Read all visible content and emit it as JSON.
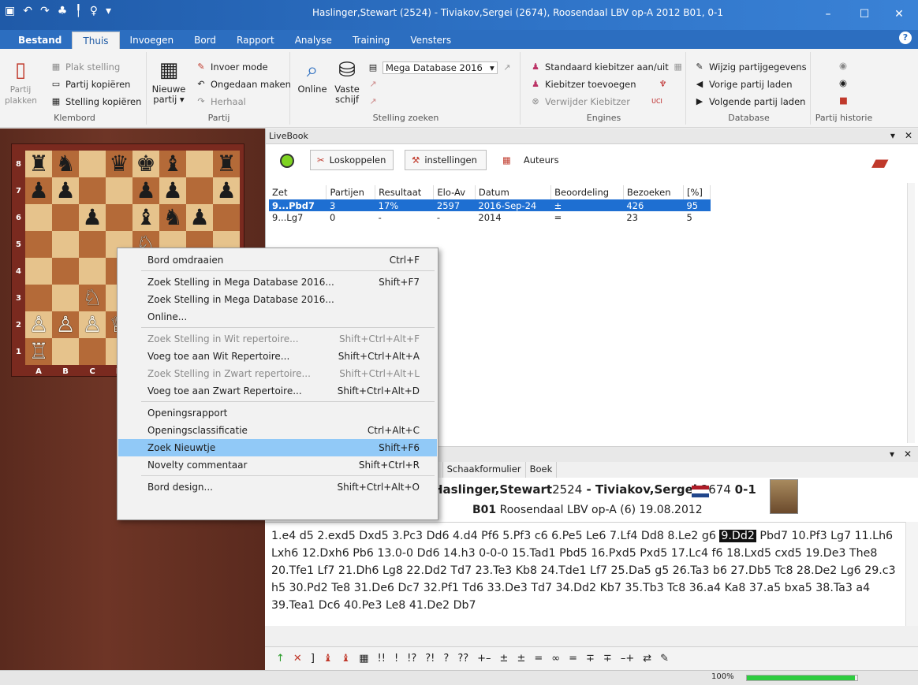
{
  "window": {
    "title": "Haslinger,Stewart (2524) - Tiviakov,Sergei (2674), Roosendaal LBV op-A 2012  B01, 0-1",
    "quick_access_icons": [
      "save-icon",
      "undo-icon",
      "redo-icon",
      "tree-icon",
      "brush-icon",
      "bulb-icon",
      "dropdown-icon"
    ],
    "controls": {
      "minimize": "–",
      "maximize": "☐",
      "close": "✕"
    }
  },
  "ribbon_tabs": [
    "Bestand",
    "Thuis",
    "Invoegen",
    "Bord",
    "Rapport",
    "Analyse",
    "Training",
    "Vensters"
  ],
  "active_tab": "Thuis",
  "ribbon": {
    "klembord": {
      "label": "Klembord",
      "paste_big": "Partij plakken",
      "items": [
        "Plak stelling",
        "Partij kopiëren",
        "Stelling kopiëren"
      ]
    },
    "partij": {
      "label": "Partij",
      "new_game": "Nieuwe partij ▾",
      "items": [
        "Invoer mode",
        "Ongedaan maken",
        "Herhaal"
      ]
    },
    "stelling_zoeken": {
      "label": "Stelling zoeken",
      "online": "Online",
      "vaste_schijf": "Vaste schijf",
      "database": "Mega Database 2016"
    },
    "engines": {
      "label": "Engines",
      "items": [
        "Standaard kiebitzer aan/uit",
        "Kiebitzer toevoegen",
        "Verwijder Kiebitzer"
      ]
    },
    "database": {
      "label": "Database",
      "items": [
        "Wijzig partijgegevens",
        "Vorige partij laden",
        "Volgende partij laden"
      ]
    },
    "historie": {
      "label": "Partij historie"
    }
  },
  "board": {
    "ranks": [
      "8",
      "7",
      "6",
      "5",
      "4",
      "3",
      "2",
      "1"
    ],
    "files": [
      "A",
      "B",
      "C",
      "D",
      "E",
      "F",
      "G",
      "H"
    ],
    "squares": [
      [
        "♜",
        "♞",
        "",
        "♛",
        "♚",
        "♝",
        "",
        "♜"
      ],
      [
        "♟",
        "♟",
        "",
        "",
        "♟",
        "♟",
        "",
        "♟"
      ],
      [
        "",
        "",
        "♟",
        "",
        "♝",
        "♞",
        "♟",
        ""
      ],
      [
        "",
        "",
        "",
        "",
        "♘",
        "",
        "",
        ""
      ],
      [
        "",
        "",
        "",
        "",
        "",
        "",
        "",
        ""
      ],
      [
        "",
        "",
        "♘",
        "",
        "",
        "",
        "",
        ""
      ],
      [
        "♙",
        "♙",
        "♙",
        "♕",
        "",
        "",
        "",
        ""
      ],
      [
        "♖",
        "",
        "",
        "",
        "",
        "",
        "",
        ""
      ]
    ],
    "colors": [
      [
        "b",
        "b",
        "",
        "b",
        "b",
        "b",
        "",
        "b"
      ],
      [
        "b",
        "b",
        "",
        "",
        "b",
        "b",
        "",
        "b"
      ],
      [
        "",
        "",
        "b",
        "",
        "b",
        "b",
        "b",
        ""
      ],
      [
        "",
        "",
        "",
        "",
        "w",
        "",
        "",
        ""
      ],
      [
        "",
        "",
        "",
        "",
        "",
        "",
        "",
        ""
      ],
      [
        "",
        "",
        "w",
        "",
        "",
        "",
        "",
        ""
      ],
      [
        "w",
        "w",
        "w",
        "w",
        "",
        "",
        "",
        ""
      ],
      [
        "w",
        "",
        "",
        "",
        "",
        "",
        "",
        ""
      ]
    ]
  },
  "livebook": {
    "title": "LiveBook",
    "buttons": {
      "disconnect": "Loskoppelen",
      "settings": "instellingen",
      "authors": "Auteurs"
    },
    "columns": [
      "Zet",
      "Partijen",
      "Resultaat",
      "Elo-Av",
      "Datum",
      "Beoordeling",
      "Bezoeken",
      "[%]"
    ],
    "rows": [
      [
        "9...Pbd7",
        "3",
        "17%",
        "2597",
        "2016-Sep-24",
        "±",
        "426",
        "95"
      ],
      [
        "9...Lg7",
        "0",
        "-",
        "-",
        "2014",
        "=",
        "23",
        "5"
      ]
    ]
  },
  "context_menu": {
    "items": [
      {
        "label": "Bord omdraaien",
        "shortcut": "Ctrl+F",
        "disabled": false
      },
      {
        "label": "Zoek Stelling in Mega Database 2016...",
        "shortcut": "Shift+F7",
        "disabled": false
      },
      {
        "label": "Zoek Stelling in Mega Database 2016...",
        "shortcut": "",
        "disabled": false
      },
      {
        "label": "Online...",
        "shortcut": "",
        "disabled": false
      },
      {
        "label": "Zoek Stelling in Wit repertoire...",
        "shortcut": "Shift+Ctrl+Alt+F",
        "disabled": true
      },
      {
        "label": "Voeg toe aan Wit Repertoire...",
        "shortcut": "Shift+Ctrl+Alt+A",
        "disabled": false
      },
      {
        "label": "Zoek Stelling in Zwart repertoire...",
        "shortcut": "Shift+Ctrl+Alt+L",
        "disabled": true
      },
      {
        "label": "Voeg toe aan Zwart Repertoire...",
        "shortcut": "Shift+Ctrl+Alt+D",
        "disabled": false
      },
      {
        "label": "Openingsrapport",
        "shortcut": "",
        "disabled": false
      },
      {
        "label": "Openingsclassificatie",
        "shortcut": "Ctrl+Alt+C",
        "disabled": false
      },
      {
        "label": "Zoek Nieuwtje",
        "shortcut": "Shift+F6",
        "disabled": false,
        "highlighted": true
      },
      {
        "label": "Novelty commentaar",
        "shortcut": "Shift+Ctrl+R",
        "disabled": false
      },
      {
        "label": "Bord design...",
        "shortcut": "Shift+Ctrl+Alt+O",
        "disabled": false
      }
    ]
  },
  "notation": {
    "tabs": [
      "ng",
      "Schaakformulier",
      "Boek"
    ],
    "white": "Haslinger,Stewart",
    "white_elo": "2524",
    "separator": " - ",
    "black": "Tiviakov,Sergei",
    "black_elo": "2674",
    "result": "0-1",
    "eco": "B01",
    "event": "Roosendaal LBV op-A (6) 19.08.2012",
    "moves_before": "1.e4 d5 2.exd5 Dxd5 3.Pc3 Dd6 4.d4 Pf6 5.Pf3 c6 6.Pe5 Le6 7.Lf4 Dd8 8.Le2 g6 ",
    "current_move": "9.Dd2",
    "moves_after": " Pbd7 10.Pf3 Lg7 11.Lh6 Lxh6 12.Dxh6 Pb6 13.0-0 Dd6 14.h3 0-0-0 15.Tad1 Pbd5 16.Pxd5 Pxd5 17.Lc4 f6 18.Lxd5 cxd5 19.De3 The8 20.Tfe1 Lf7 21.Dh6 Lg8 22.Dd2 Td7 23.Te3 Kb8 24.Tde1 Lf7 25.Da5 g5 26.Ta3 b6 27.Db5 Tc8 28.De2 Lg6 29.c3 h5 30.Pd2 Te8 31.De6 Dc7 32.Pf1 Td6 33.De3 Td7 34.Dd2 Kb7 35.Tb3 Tc8 36.a4 Ka8 37.a5 bxa5 38.Ta3 a4 39.Tea1 Dc6 40.Pe3 Le8 41.De2 Db7"
  },
  "annotation_bar": [
    "↑",
    "✕",
    "]",
    "♝",
    "♝",
    "▦",
    "!!",
    "!",
    "!?",
    "?!",
    "?",
    "??",
    "+–",
    "±",
    "±",
    "=",
    "∞",
    "=",
    "∓",
    "∓",
    "–+",
    "⇄",
    "✎"
  ],
  "status": {
    "zoom": "100%",
    "progress": 0.98
  },
  "colors": {
    "titlebar": "#2f74c8",
    "selection": "#1e6fd2",
    "menu_highlight": "#91c9f7"
  }
}
